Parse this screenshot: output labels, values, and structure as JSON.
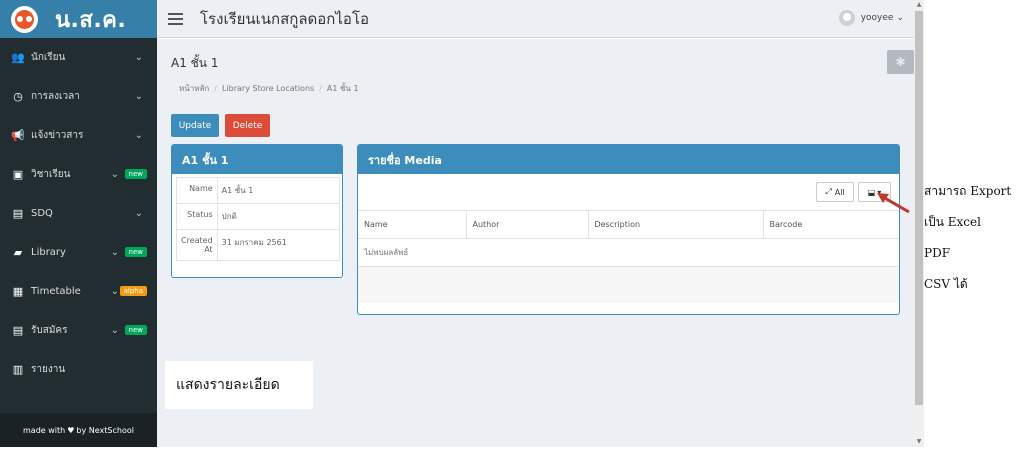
{
  "brand": {
    "logo_text": "น.ส.ค."
  },
  "sidebar": {
    "items": [
      {
        "label": "นักเรียน",
        "icon": "users-icon"
      },
      {
        "label": "การลงเวลา",
        "icon": "clock-icon"
      },
      {
        "label": "แจ้งข่าวสาร",
        "icon": "bullhorn-icon"
      },
      {
        "label": "วิชาเรียน",
        "icon": "calendar-icon",
        "badge": "new"
      },
      {
        "label": "SDQ",
        "icon": "clipboard-icon"
      },
      {
        "label": "Library",
        "icon": "book-icon",
        "badge": "new"
      },
      {
        "label": "Timetable",
        "icon": "table-icon",
        "badge": "alpha"
      },
      {
        "label": "รับสมัคร",
        "icon": "form-icon",
        "badge": "new"
      },
      {
        "label": "รายงาน",
        "icon": "bar-chart-icon"
      }
    ],
    "footer": {
      "prefix": "made with",
      "suffix": "by NextSchool"
    }
  },
  "header": {
    "title": "โรงเรียนเนกสกูลดอกไอโอ",
    "user": "yooyee"
  },
  "page": {
    "title": "A1 ชั้น 1",
    "breadcrumb": [
      "หน้าหลัก",
      "Library Store Locations",
      "A1 ชั้น 1"
    ],
    "buttons": {
      "update": "Update",
      "delete": "Delete"
    }
  },
  "detail": {
    "heading": "A1 ชั้น 1",
    "rows": [
      {
        "key": "Name",
        "value": "A1 ชั้น 1"
      },
      {
        "key": "Status",
        "value": "ปกติ"
      },
      {
        "key": "Created At",
        "value": "31 มกราคม 2561"
      }
    ]
  },
  "media": {
    "heading": "รายชื่อ Media",
    "all_label": "All",
    "columns": [
      "Name",
      "Author",
      "Description",
      "Barcode"
    ],
    "empty_text": "ไม่พบผลลัพธ์"
  },
  "annotations": {
    "detail_note": "แสดงรายละเอียด",
    "export_note": [
      "สามารถ Export",
      "เป็น Excel",
      "PDF",
      "CSV ได้"
    ]
  },
  "colors": {
    "primary": "#3c8dbc",
    "danger": "#dd4b39",
    "sidebar": "#222d32",
    "arrow": "#c0392b"
  }
}
